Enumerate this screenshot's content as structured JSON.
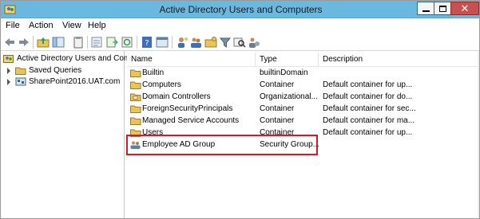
{
  "window": {
    "title": "Active Directory Users and Computers"
  },
  "menu": [
    {
      "label": "File"
    },
    {
      "label": "Action"
    },
    {
      "label": "View"
    },
    {
      "label": "Help"
    }
  ],
  "toolbar": {
    "icons": [
      "back-arrow-icon",
      "forward-arrow-icon",
      "up-folder-icon",
      "show-tree-icon",
      "clipboard-icon",
      "properties-icon",
      "export-list-icon",
      "refresh-icon",
      "help-icon",
      "console-icon",
      "new-user-icon",
      "new-group-icon",
      "new-ou-icon",
      "filter-icon",
      "find-icon",
      "add-to-group-icon"
    ]
  },
  "tree": {
    "root_label": "Active Directory Users and Com",
    "items": [
      {
        "label": "Saved Queries"
      },
      {
        "label": "SharePoint2016.UAT.com"
      }
    ]
  },
  "list": {
    "columns": [
      {
        "label": "Name"
      },
      {
        "label": "Type"
      },
      {
        "label": "Description"
      }
    ],
    "rows": [
      {
        "name": "Builtin",
        "type": "builtinDomain",
        "description": "",
        "icon": "folder-icon"
      },
      {
        "name": "Computers",
        "type": "Container",
        "description": "Default container for up...",
        "icon": "folder-icon"
      },
      {
        "name": "Domain Controllers",
        "type": "Organizational...",
        "description": "Default container for do...",
        "icon": "ou-folder-icon"
      },
      {
        "name": "ForeignSecurityPrincipals",
        "type": "Container",
        "description": "Default container for sec...",
        "icon": "folder-icon"
      },
      {
        "name": "Managed Service Accounts",
        "type": "Container",
        "description": "Default container for ma...",
        "icon": "folder-icon"
      },
      {
        "name": "Users",
        "type": "Container",
        "description": "Default container for up...",
        "icon": "folder-icon"
      },
      {
        "name": "Employee AD Group",
        "type": "Security Group...",
        "description": "",
        "icon": "security-group-icon"
      }
    ]
  },
  "colors": {
    "titlebar": "#6ab8e0",
    "close_button": "#c75050",
    "highlight": "#d4192b",
    "folder": "#e8c45a"
  }
}
